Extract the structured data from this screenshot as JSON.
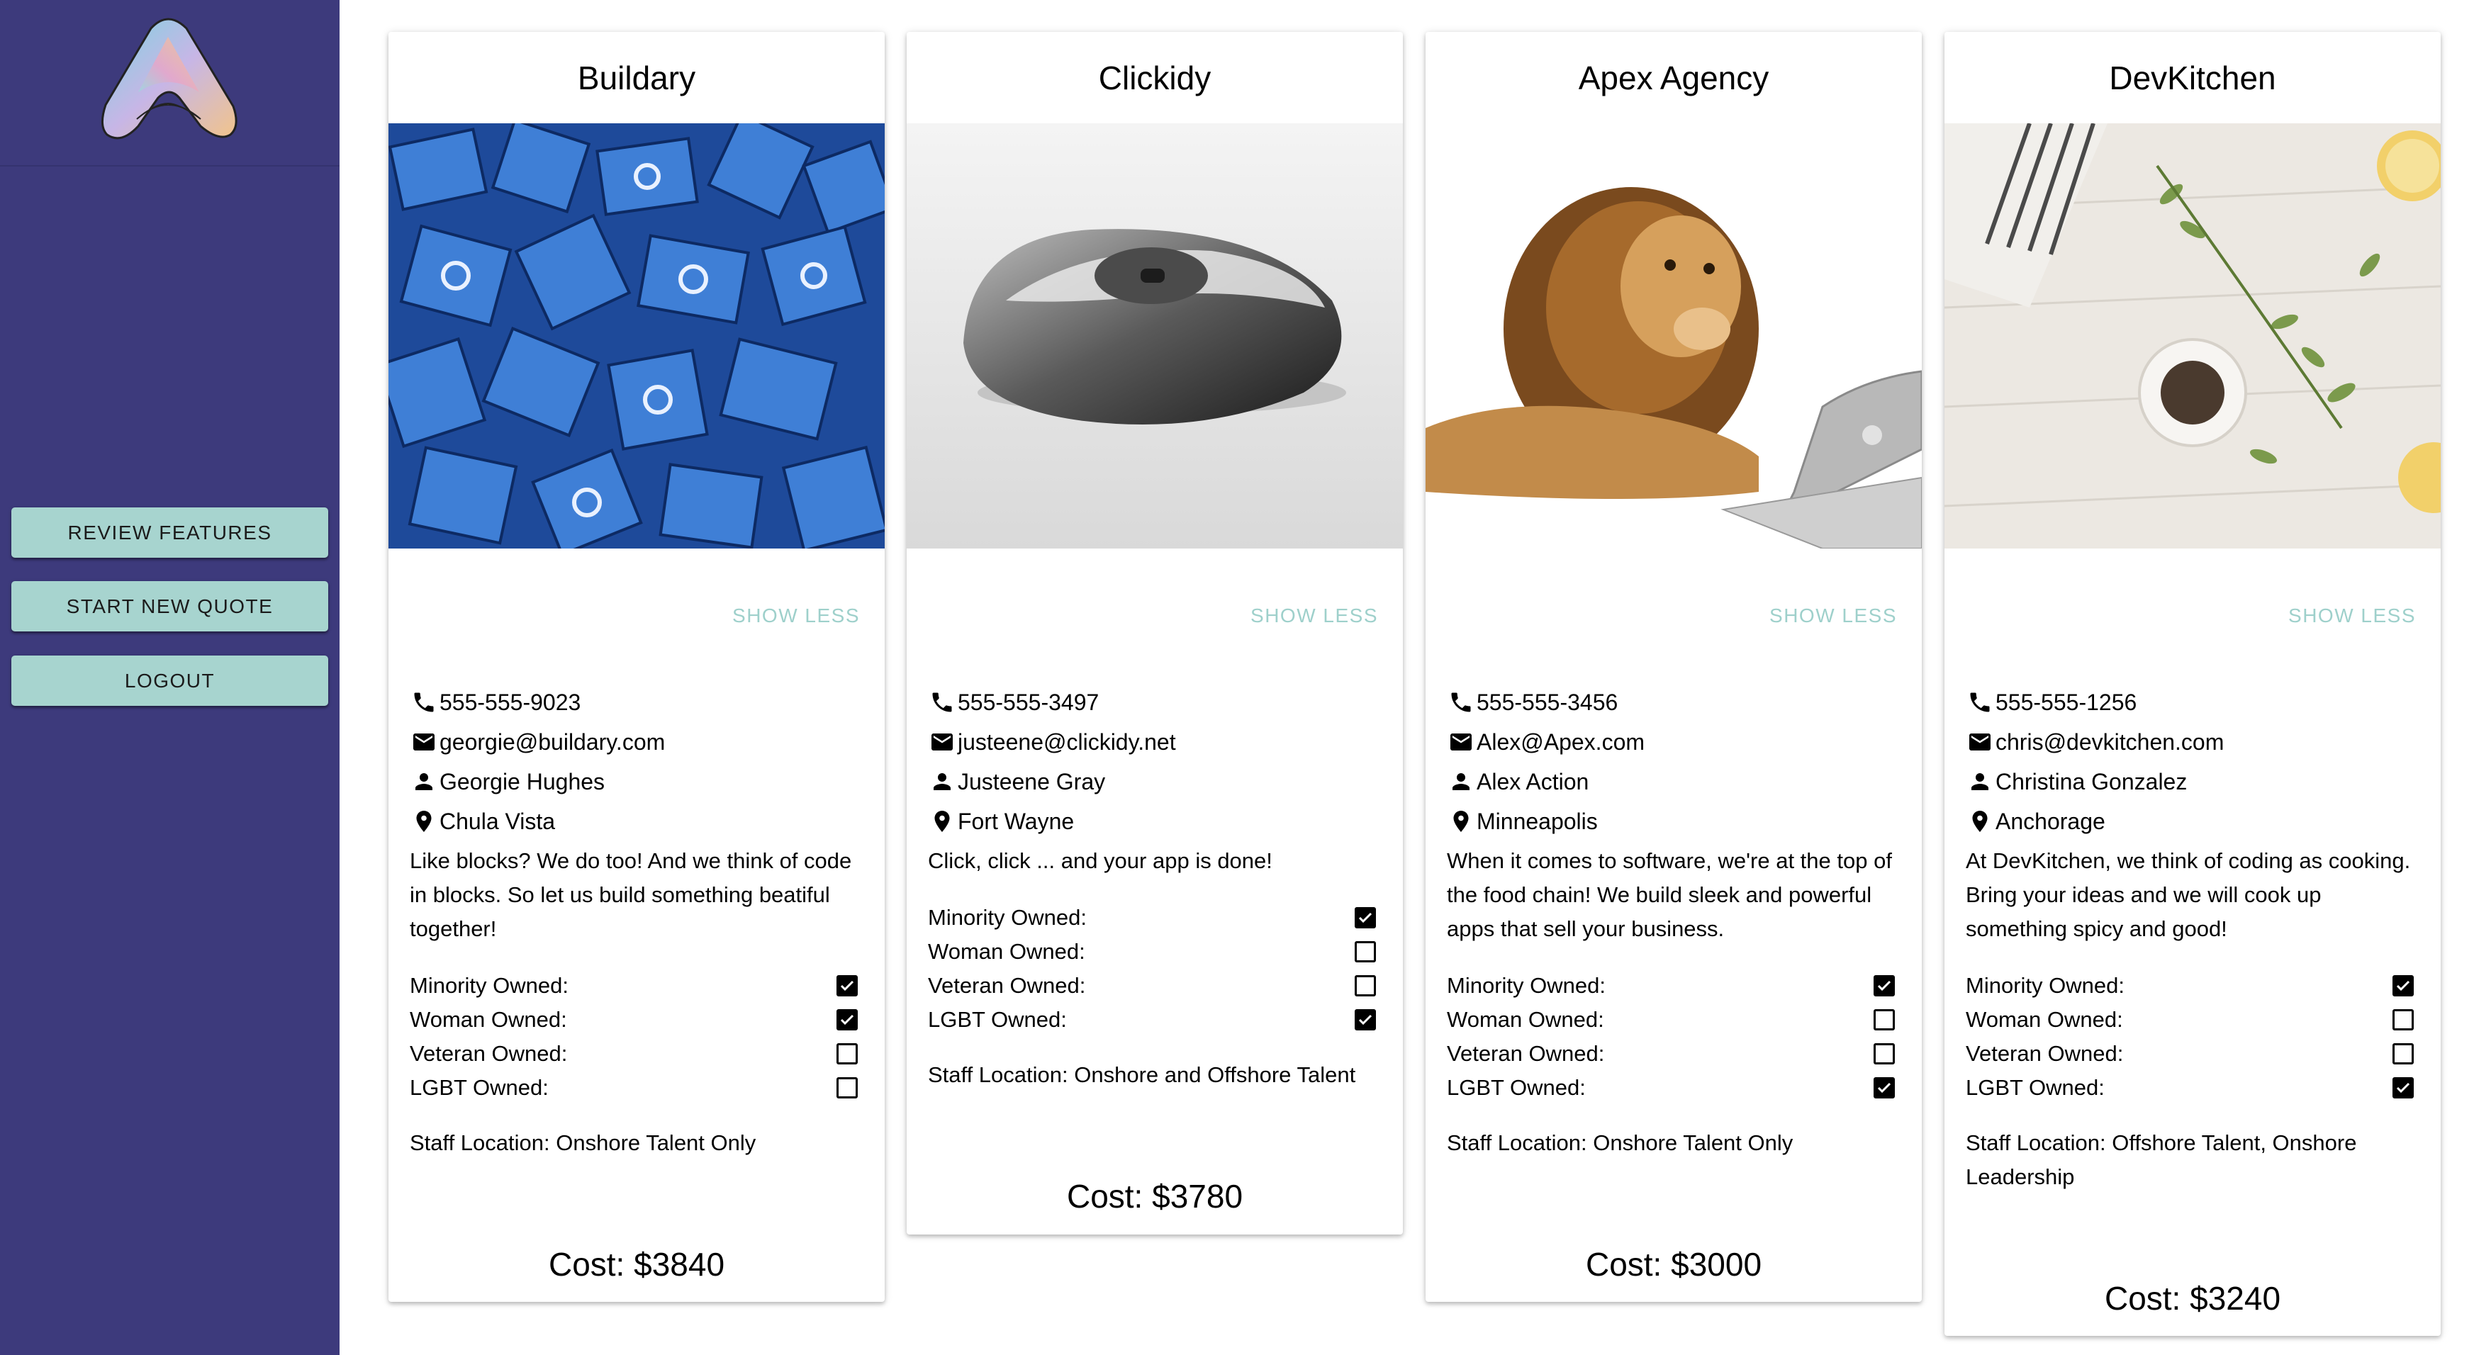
{
  "sidebar": {
    "buttons": [
      "REVIEW FEATURES",
      "START NEW QUOTE",
      "LOGOUT"
    ]
  },
  "colors": {
    "sidebar": "#3d3a7c",
    "button": "#a7d4cf",
    "show_less": "#9ed0cb"
  },
  "cards": [
    {
      "title": "Buildary",
      "image": "blue-blocks-photo",
      "show_less": "SHOW LESS",
      "phone": "555-555-9023",
      "email": "georgie@buildary.com",
      "contact": "Georgie Hughes",
      "location": "Chula Vista",
      "description": "Like blocks? We do too! And we think of code in blocks. So let us build something beatiful together!",
      "ownership": [
        {
          "label": "Minority Owned:",
          "checked": true
        },
        {
          "label": "Woman Owned:",
          "checked": true
        },
        {
          "label": "Veteran Owned:",
          "checked": false
        },
        {
          "label": "LGBT Owned:",
          "checked": false
        }
      ],
      "staff": "Staff Location: Onshore Talent Only",
      "cost": "Cost: $3840"
    },
    {
      "title": "Clickidy",
      "image": "computer-mouse-photo",
      "show_less": "SHOW LESS",
      "phone": "555-555-3497",
      "email": "justeene@clickidy.net",
      "contact": "Justeene Gray",
      "location": "Fort Wayne",
      "description": "Click, click ... and your app is done!",
      "ownership": [
        {
          "label": "Minority Owned:",
          "checked": true
        },
        {
          "label": "Woman Owned:",
          "checked": false
        },
        {
          "label": "Veteran Owned:",
          "checked": false
        },
        {
          "label": "LGBT Owned:",
          "checked": true
        }
      ],
      "staff": "Staff Location: Onshore and Offshore Talent",
      "cost": "Cost: $3780"
    },
    {
      "title": "Apex Agency",
      "image": "lion-with-laptop-photo",
      "show_less": "SHOW LESS",
      "phone": "555-555-3456",
      "email": "Alex@Apex.com",
      "contact": "Alex Action",
      "location": "Minneapolis",
      "description": "When it comes to software, we're at the top of the food chain! We build sleek and powerful apps that sell your business.",
      "ownership": [
        {
          "label": "Minority Owned:",
          "checked": true
        },
        {
          "label": "Woman Owned:",
          "checked": false
        },
        {
          "label": "Veteran Owned:",
          "checked": false
        },
        {
          "label": "LGBT Owned:",
          "checked": true
        }
      ],
      "staff": "Staff Location: Onshore Talent Only",
      "cost": "Cost: $3000"
    },
    {
      "title": "DevKitchen",
      "image": "kitchen-herbs-photo",
      "show_less": "SHOW LESS",
      "phone": "555-555-1256",
      "email": "chris@devkitchen.com",
      "contact": "Christina Gonzalez",
      "location": "Anchorage",
      "description": "At DevKitchen, we think of coding as cooking. Bring your ideas and we will cook up something spicy and good!",
      "ownership": [
        {
          "label": "Minority Owned:",
          "checked": true
        },
        {
          "label": "Woman Owned:",
          "checked": false
        },
        {
          "label": "Veteran Owned:",
          "checked": false
        },
        {
          "label": "LGBT Owned:",
          "checked": true
        }
      ],
      "staff": "Staff Location: Offshore Talent, Onshore Leadership",
      "cost": "Cost: $3240"
    }
  ]
}
